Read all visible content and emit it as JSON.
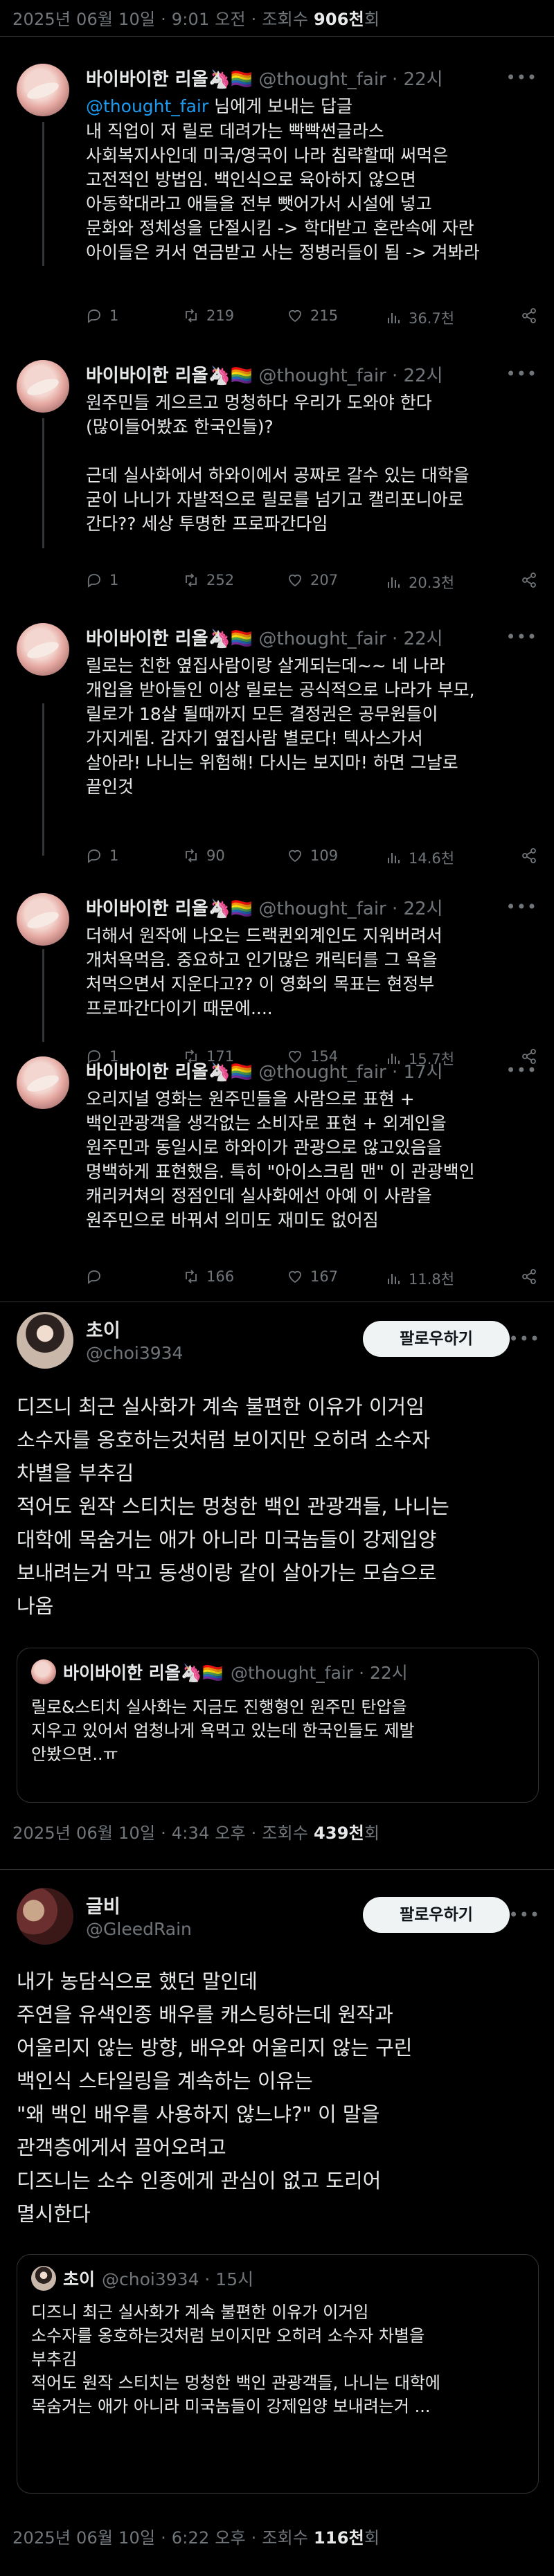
{
  "top_meta": {
    "text": "2025년 06월 10일 · 9:01 오전 · 조회수 ",
    "count": "906천",
    "suffix": "회"
  },
  "replies": [
    {
      "name": "바이바이한 리올🦄🏳️‍🌈",
      "handle": "@thought_fair · 22시",
      "reply_to_prefix": "",
      "reply_to_handle": "@thought_fair",
      "reply_to_suffix": " 님에게 보내는 답글",
      "text": "내 직업이 저 릴로 데려가는 빡빡썬글라스\n사회복지사인데 미국/영국이 나라 침략할때 써먹은\n고전적인 방법임. 백인식으로 육아하지 않으면\n아동학대라고 애들을 전부 뺏어가서 시설에 넣고\n문화와 정체성을 단절시킴 -> 학대받고 혼란속에 자란\n아이들은 커서 연금받고 사는 정병러들이 됨 -> 겨봐라",
      "replies": "1",
      "retweets": "219",
      "likes": "215",
      "views": "36.7천"
    },
    {
      "name": "바이바이한 리올🦄🏳️‍🌈",
      "handle": "@thought_fair · 22시",
      "text": "원주민들 게으르고 멍청하다 우리가 도와야 한다\n(많이들어봤죠 한국인들)?\n\n근데 실사화에서 하와이에서 공짜로 갈수 있는 대학을\n굳이 나니가 자발적으로 릴로를 넘기고 캘리포니아로\n간다?? 세상 투명한 프로파간다임",
      "replies": "1",
      "retweets": "252",
      "likes": "207",
      "views": "20.3천"
    },
    {
      "name": "바이바이한 리올🦄🏳️‍🌈",
      "handle": "@thought_fair · 22시",
      "text": "릴로는 친한 옆집사람이랑 살게되는데~~ 네 나라\n개입을 받아들인 이상 릴로는 공식적으로 나라가 부모,\n릴로가 18살 될때까지 모든 결정권은 공무원들이\n가지게됨. 감자기 옆집사람 별로다! 텍사스가서\n살아라! 나니는 위험해! 다시는 보지마! 하면 그날로\n끝인것",
      "replies": "1",
      "retweets": "90",
      "likes": "109",
      "views": "14.6천"
    },
    {
      "name": "바이바이한 리올🦄🏳️‍🌈",
      "handle": "@thought_fair · 22시",
      "text": "더해서 원작에 나오는 드랙퀸외계인도 지워버려서\n개처욕먹음. 중요하고 인기많은 캐릭터를 그 욕을\n처먹으면서 지운다고?? 이 영화의 목표는 현정부\n프로파간다이기 때문에....",
      "replies": "1",
      "retweets": "171",
      "likes": "154",
      "views": "15.7천"
    },
    {
      "name": "바이바이한 리올🦄🏳️‍🌈",
      "handle": "@thought_fair · 17시",
      "text": "오리지널 영화는 원주민들을 사람으로 표현 +\n백인관광객을 생각없는 소비자로 표현 + 외계인을\n원주민과 동일시로 하와이가 관광으로 않고있음을\n명백하게 표현했음. 특히 \"아이스크림 맨\" 이 관광백인\n캐리커쳐의 정점인데 실사화에선 아예 이 사람을\n원주민으로 바꿔서 의미도 재미도 없어짐",
      "replies": "",
      "retweets": "166",
      "likes": "167",
      "views": "11.8천"
    }
  ],
  "main_tweets": [
    {
      "name": "초이",
      "handle": "@choi3934",
      "follow": "팔로우하기",
      "text": "디즈니 최근 실사화가 계속 불편한 이유가 이거임\n소수자를 옹호하는것처럼 보이지만 오히려 소수자\n차별을 부추김\n적어도 원작 스티치는 멍청한 백인 관광객들, 나니는\n대학에 목숨거는 애가 아니라 미국놈들이 강제입양\n보내려는거 막고 동생이랑 같이 살아가는 모습으로\n나옴",
      "quote": {
        "name": "바이바이한 리올🦄🏳️‍🌈",
        "handle": "@thought_fair · 22시",
        "text": "릴로&스티치 실사화는 지금도 진행형인 원주민 탄압을\n지우고 있어서 엄청나게 욕먹고 있는데 한국인들도 제발\n안봤으면..ㅠ"
      },
      "meta": {
        "text": "2025년 06월 10일 · 4:34 오후 · 조회수 ",
        "count": "439천",
        "suffix": "회"
      }
    },
    {
      "name": "글비",
      "handle": "@GleedRain",
      "follow": "팔로우하기",
      "text": "내가 농담식으로 했던 말인데\n주연을 유색인종 배우를 캐스팅하는데 원작과\n어울리지 않는 방향, 배우와 어울리지 않는 구린\n백인식 스타일링을 계속하는 이유는\n\"왜 백인 배우를 사용하지 않느냐?\" 이 말을\n관객층에게서 끌어오려고\n디즈니는 소수 인종에게 관심이 없고 도리어\n멸시한다",
      "quote": {
        "name": "초이",
        "handle": "@choi3934 · 15시",
        "text": "디즈니 최근 실사화가 계속 불편한 이유가 이거임\n소수자를 옹호하는것처럼 보이지만 오히려 소수자 차별을\n부추김\n적어도 원작 스티치는 멍청한 백인 관광객들, 나니는 대학에\n목숨거는 애가 아니라 미국놈들이 강제입양 보내려는거 ..."
      },
      "meta": {
        "text": "2025년 06월 10일 · 6:22 오후 · 조회수 ",
        "count": "116천",
        "suffix": "회"
      }
    }
  ],
  "icons": {
    "reply": "reply-icon",
    "retweet": "retweet-icon",
    "like": "heart-icon",
    "views": "views-icon",
    "share": "share-icon"
  },
  "colors": {
    "bg": "#000000",
    "text": "#e7e9ea",
    "muted": "#71767b",
    "link": "#1d9bf0",
    "border": "#2f3336"
  }
}
